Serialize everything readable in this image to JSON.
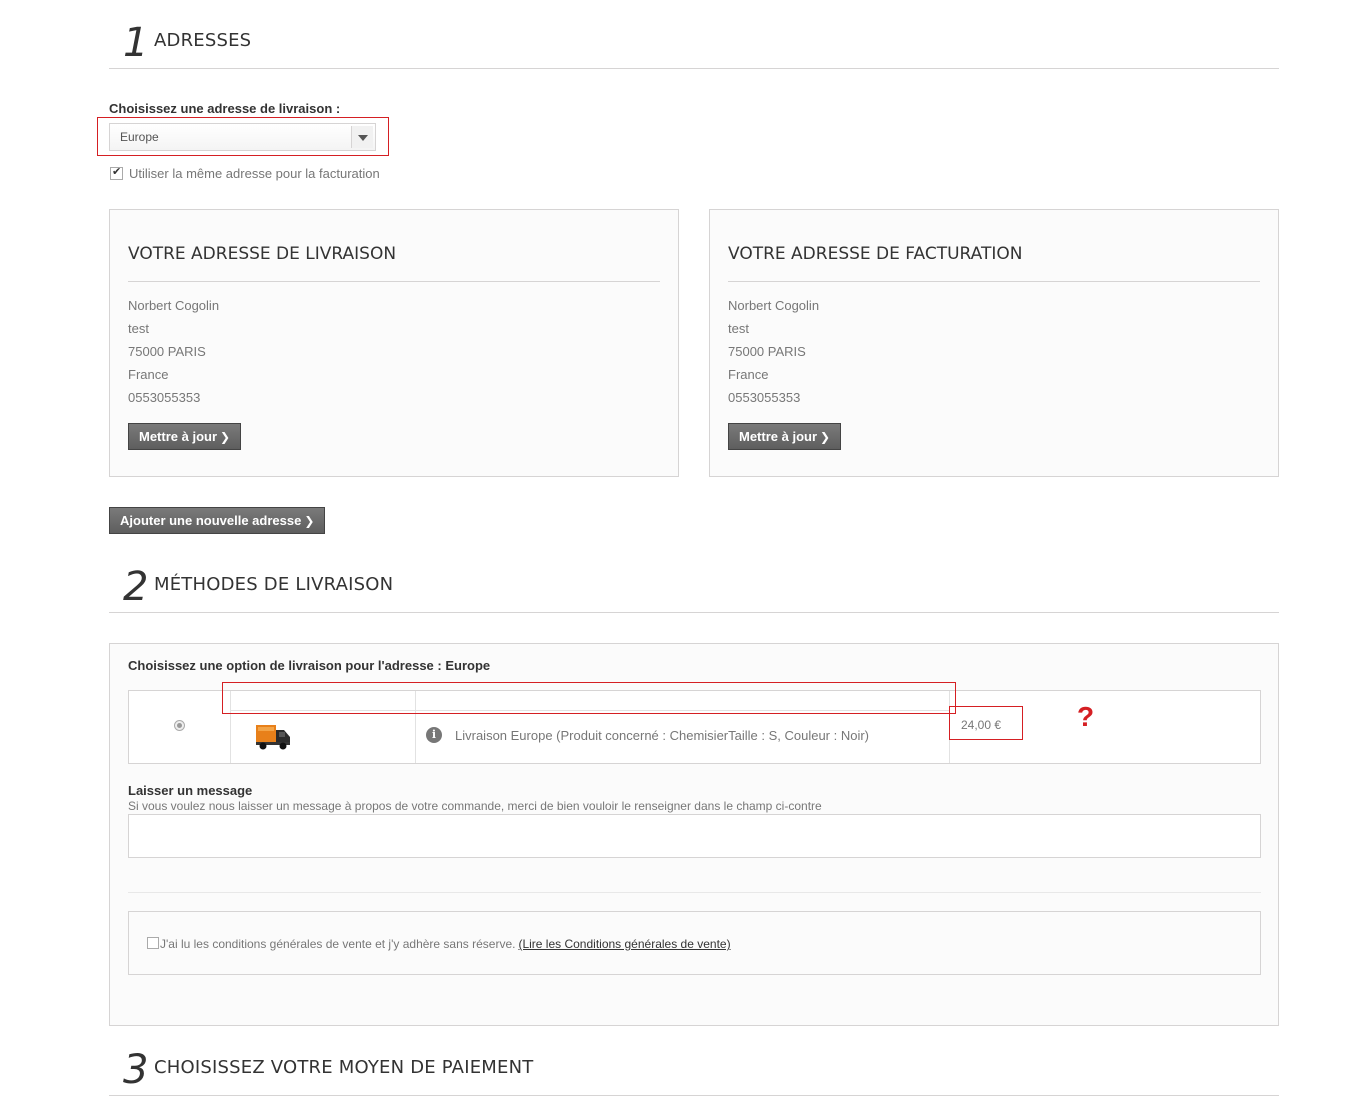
{
  "step1": {
    "number": "1",
    "title": "ADRESSES"
  },
  "delivery_address": {
    "label": "Choisissez une adresse de livraison :",
    "selected": "Europe",
    "same_for_billing_label": "Utiliser la même adresse pour la facturation",
    "same_for_billing_checked": true
  },
  "shipping_box": {
    "title": "VOTRE ADRESSE DE LIVRAISON",
    "lines": [
      "Norbert Cogolin",
      "test",
      "75000 PARIS",
      "France",
      "0553055353"
    ],
    "button": "Mettre à jour"
  },
  "billing_box": {
    "title": "VOTRE ADRESSE DE FACTURATION",
    "lines": [
      "Norbert Cogolin",
      "test",
      "75000 PARIS",
      "France",
      "0553055353"
    ],
    "button": "Mettre à jour"
  },
  "add_address_button": "Ajouter une nouvelle adresse",
  "step2": {
    "number": "2",
    "title": "MÉTHODES DE LIVRAISON"
  },
  "delivery": {
    "label": "Choisissez une option de livraison pour l'adresse : Europe",
    "carrier": {
      "description": "Livraison Europe (Produit concerné : ChemisierTaille : S, Couleur : Noir)",
      "price": "24,00 €",
      "icon": "truck-icon"
    },
    "annotation": "?"
  },
  "message": {
    "label": "Laisser un message",
    "help": "Si vous voulez nous laisser un message à propos de votre commande, merci de bien vouloir le renseigner dans le champ ci-contre",
    "value": ""
  },
  "terms": {
    "text": "J'ai lu les conditions générales de vente et j'y adhère sans réserve.",
    "link": "(Lire les Conditions générales de vente)",
    "checked": false
  },
  "step3": {
    "number": "3",
    "title": "CHOISISSEZ VOTRE MOYEN DE PAIEMENT"
  },
  "colors": {
    "annotation_red": "#d51f23",
    "button_gray": "#666666",
    "border": "#d6d4d4"
  }
}
